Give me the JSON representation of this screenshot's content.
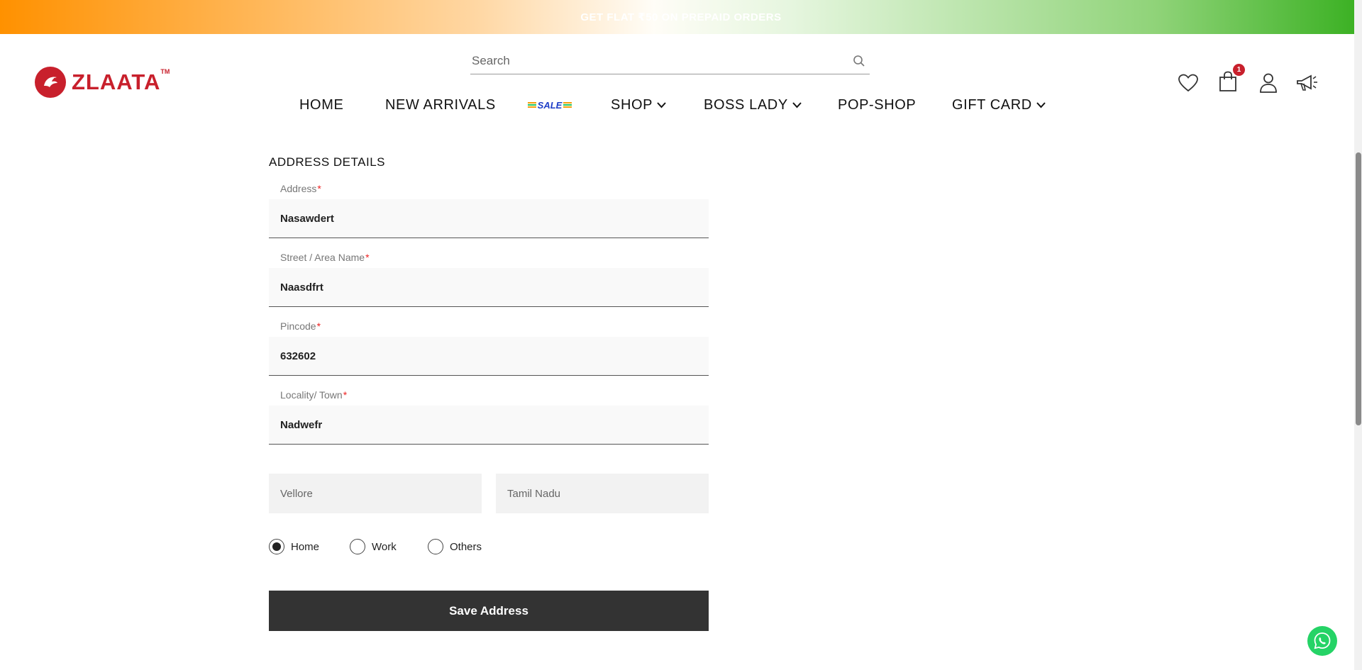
{
  "banner": {
    "text": "GET FLAT ₹50 ON PREPAID ORDERS",
    "colors": [
      "#ff9100",
      "#ffffff",
      "#39b021"
    ]
  },
  "brand": {
    "name": "ZLAATA",
    "trademark": "TM",
    "color": "#c8202c"
  },
  "search": {
    "placeholder": "Search",
    "icon": "search-icon"
  },
  "nav": {
    "home": "HOME",
    "new_arrivals": "NEW ARRIVALS",
    "sale": "SALE",
    "shop": "SHOP",
    "boss_lady": "BOSS LADY",
    "pop_shop": "POP-SHOP",
    "gift_card": "GIFT CARD"
  },
  "header_icons": {
    "wishlist": "heart-icon",
    "cart": "bag-icon",
    "cart_count": "1",
    "account": "user-icon",
    "announcements": "megaphone-icon"
  },
  "form": {
    "title": "ADDRESS DETAILS",
    "address": {
      "label": "Address",
      "value": "Nasawdert"
    },
    "street": {
      "label": "Street / Area Name",
      "value": "Naasdfrt"
    },
    "pincode": {
      "label": "Pincode",
      "value": "632602"
    },
    "locality": {
      "label": "Locality/ Town",
      "value": "Nadwefr"
    },
    "city": {
      "value": "Vellore"
    },
    "state": {
      "value": "Tamil Nadu"
    },
    "required_mark": "*",
    "address_type": {
      "options": [
        "Home",
        "Work",
        "Others"
      ],
      "selected": "Home"
    },
    "save_label": "Save Address"
  },
  "colors": {
    "button_bg": "#333333",
    "required": "#e22222",
    "whatsapp": "#25d366"
  }
}
